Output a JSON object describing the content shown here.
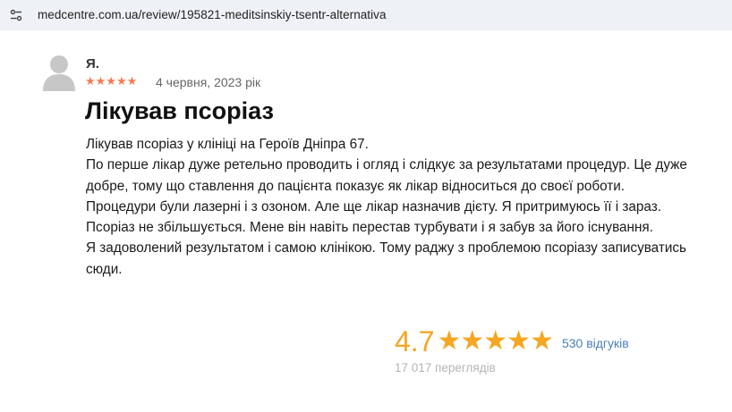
{
  "browser": {
    "url": "medcentre.com.ua/review/195821-meditsinskiy-tsentr-alternativa",
    "site_info_icon": "tune-icon"
  },
  "review": {
    "author": "Я.",
    "stars_display": "★★★★★",
    "rating": 5,
    "date": "4 червня, 2023 рік",
    "title": "Лікував псоріаз",
    "paragraphs": [
      "Лікував псоріаз у клініці на Героїв Дніпра 67.",
      "По перше лікар дуже ретельно проводить і огляд і слідкує за результатами процедур. Це дуже добре, тому що ставлення до пацієнта показує як лікар відноситься до своєї роботи.",
      "Процедури були лазерні і з озоном. Але ще лікар назначив дієту. Я притримуюсь її і зараз. Псоріаз не збільшується. Мене він навіть перестав турбувати і я забув за його існування.",
      "Я задоволений результатом і самою клінікою. Тому раджу з проблемою псоріазу записуватись сюди."
    ],
    "star_color": "#f37b52"
  },
  "summary": {
    "rating_value": "4.7",
    "stars_display": "★★★★★",
    "count_label": "530 відгуків",
    "views_label": "17 017 переглядів",
    "accent_color": "#f5a623"
  }
}
